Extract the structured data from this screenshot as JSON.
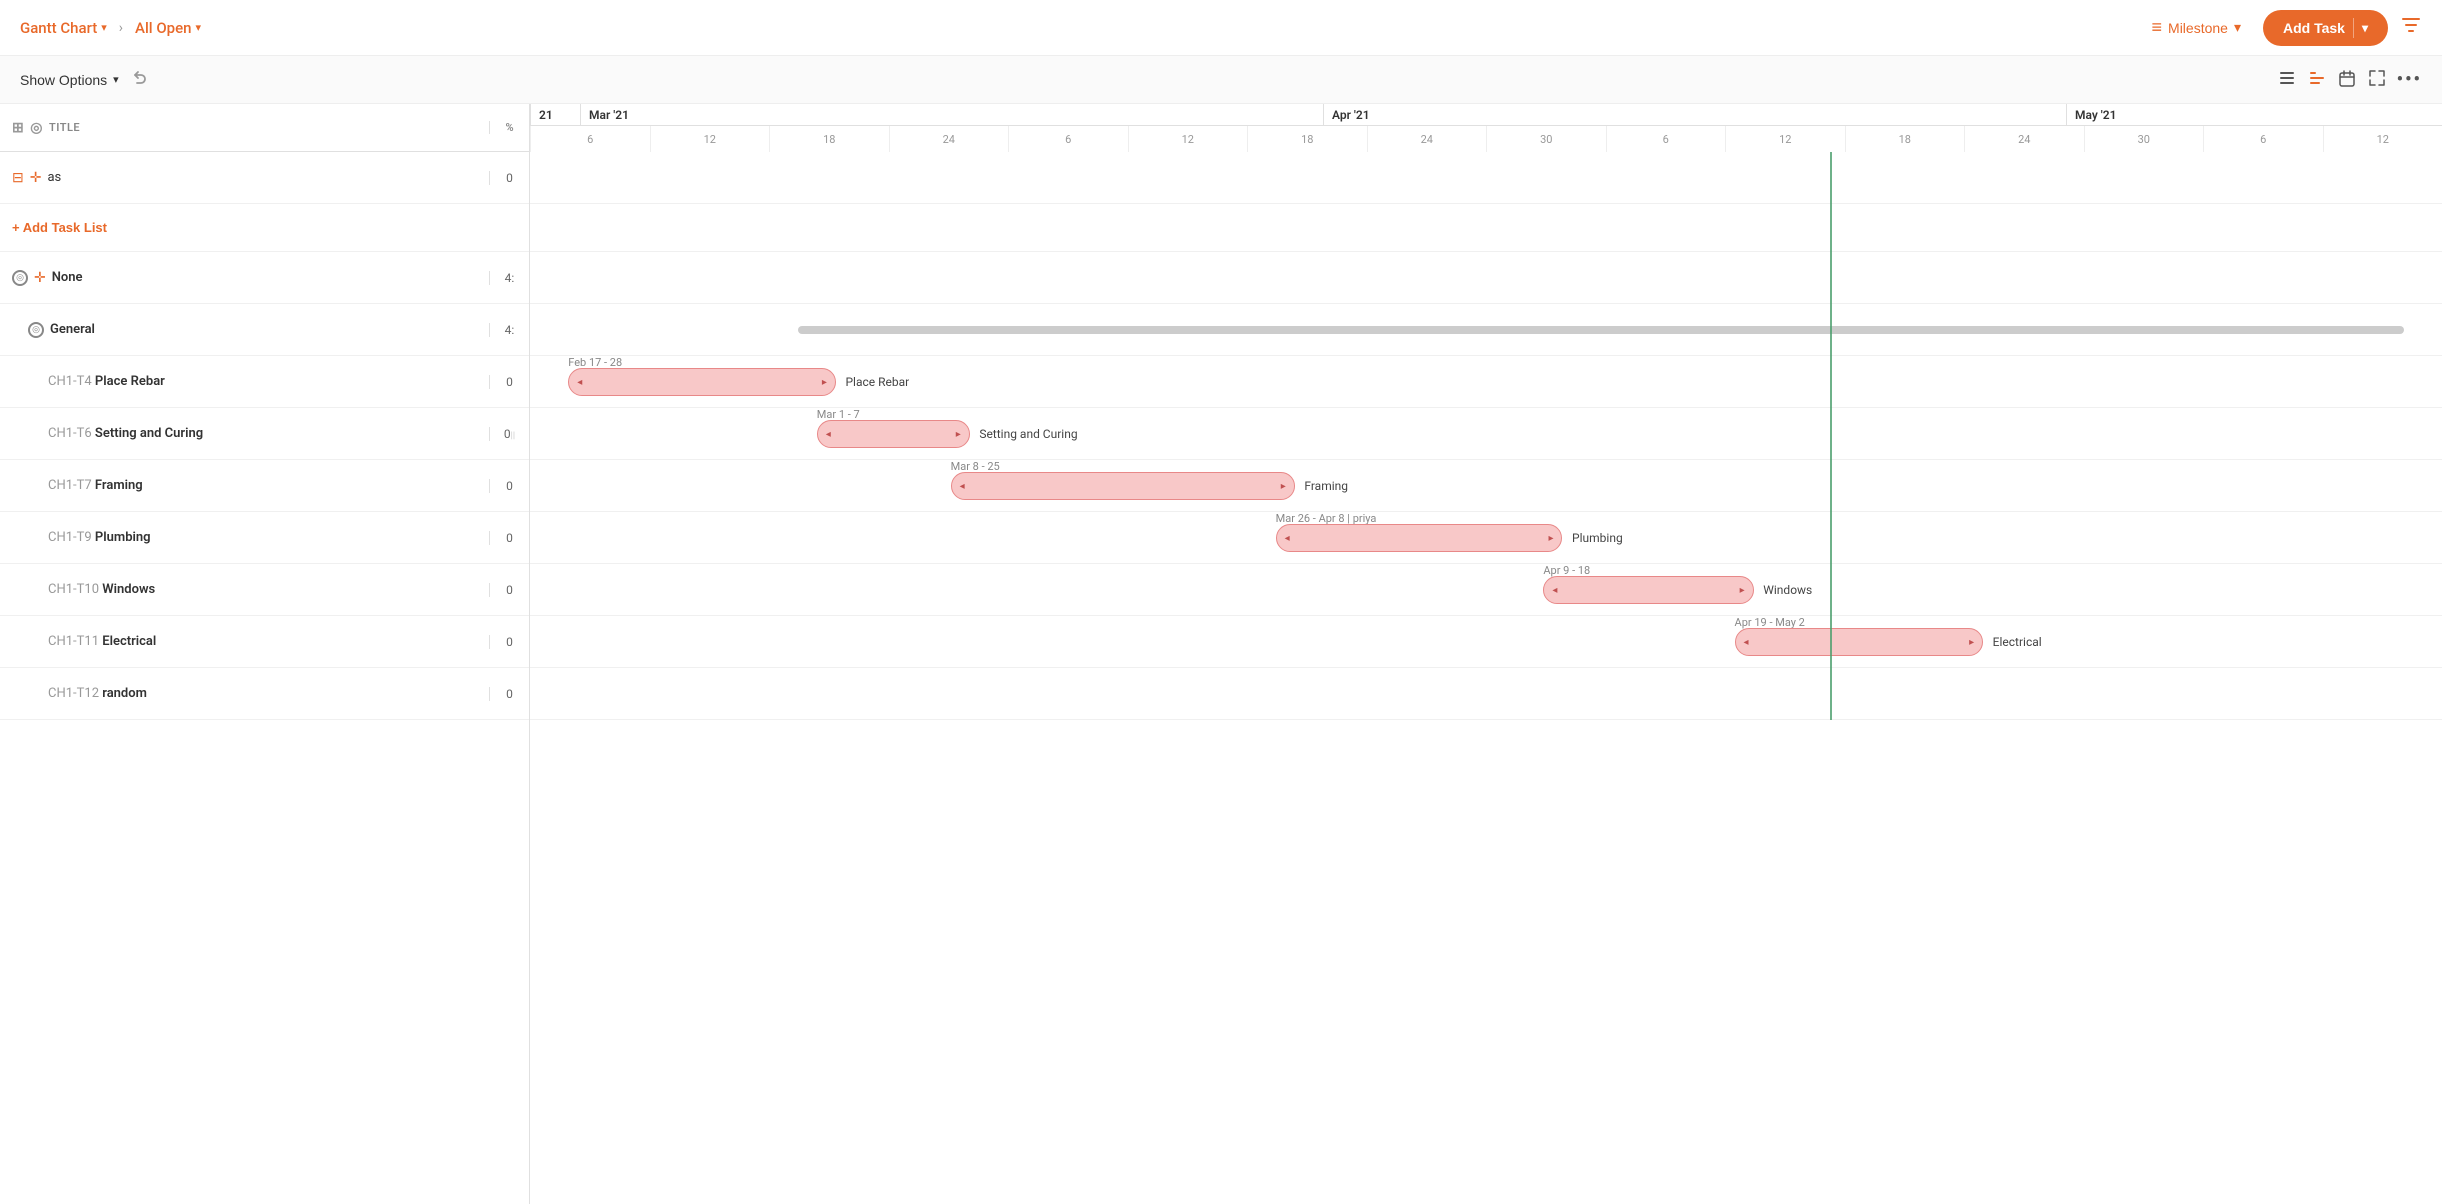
{
  "topbar": {
    "gantt_label": "Gantt Chart",
    "breadcrumb_sep": "›",
    "all_open_label": "All Open",
    "milestone_label": "Milestone",
    "add_task_label": "Add Task",
    "filter_icon": "filter-icon"
  },
  "toolbar": {
    "show_options_label": "Show Options",
    "undo_label": "↩",
    "icons": [
      "list-icon",
      "list-indent-icon",
      "calendar-icon",
      "expand-icon",
      "more-icon"
    ]
  },
  "header": {
    "title_label": "TITLE",
    "pct_label": "%"
  },
  "tasks": [
    {
      "id": "as-row",
      "indent": 0,
      "id_label": "",
      "label": "as",
      "pct": "0",
      "is_section": false,
      "has_move": true,
      "has_circle": true
    },
    {
      "id": "add-task-list",
      "type": "add",
      "label": "Add Task List"
    },
    {
      "id": "none-row",
      "indent": 0,
      "id_label": "",
      "label": "None",
      "pct": "4:",
      "is_section": true,
      "has_move": true,
      "has_circle": true
    },
    {
      "id": "general-row",
      "indent": 1,
      "id_label": "",
      "label": "General",
      "pct": "4:",
      "is_section": true,
      "has_circle": true
    },
    {
      "id": "t4-row",
      "indent": 2,
      "id_label": "CH1-T4",
      "label": "Place Rebar",
      "pct": "0",
      "is_section": false
    },
    {
      "id": "t6-row",
      "indent": 2,
      "id_label": "CH1-T6",
      "label": "Setting and Curing",
      "pct": "0",
      "is_section": false,
      "has_resize": true
    },
    {
      "id": "t7-row",
      "indent": 2,
      "id_label": "CH1-T7",
      "label": "Framing",
      "pct": "0",
      "is_section": false
    },
    {
      "id": "t9-row",
      "indent": 2,
      "id_label": "CH1-T9",
      "label": "Plumbing",
      "pct": "0",
      "is_section": false
    },
    {
      "id": "t10-row",
      "indent": 2,
      "id_label": "CH1-T10",
      "label": "Windows",
      "pct": "0",
      "is_section": false
    },
    {
      "id": "t11-row",
      "indent": 2,
      "id_label": "CH1-T11",
      "label": "Electrical",
      "pct": "0",
      "is_section": false
    },
    {
      "id": "t12-row",
      "indent": 2,
      "id_label": "CH1-T12",
      "label": "random",
      "pct": "0",
      "is_section": false
    }
  ],
  "gantt": {
    "months": [
      {
        "label": "21",
        "span": 1
      },
      {
        "label": "Mar '21",
        "span": 6
      },
      {
        "label": "Apr '21",
        "span": 6
      },
      {
        "label": "May '21",
        "span": 3
      }
    ],
    "days": [
      "6",
      "12",
      "18",
      "24",
      "6",
      "12",
      "18",
      "24",
      "30",
      "6",
      "12",
      "18",
      "24",
      "30",
      "6",
      "12"
    ],
    "bars": [
      {
        "row": 4,
        "date_label": "Feb 17 - 28",
        "right_label": "Place Rebar",
        "left_pct": 2,
        "width_pct": 14
      },
      {
        "row": 5,
        "date_label": "Mar 1 - 7",
        "right_label": "Setting and Curing",
        "left_pct": 15,
        "width_pct": 8
      },
      {
        "row": 6,
        "date_label": "Mar 8 - 25",
        "right_label": "Framing",
        "left_pct": 22,
        "width_pct": 18
      },
      {
        "row": 7,
        "date_label": "Mar 26 - Apr 8 | priya",
        "right_label": "Plumbing",
        "left_pct": 39,
        "width_pct": 15
      },
      {
        "row": 8,
        "date_label": "Apr 9 - 18",
        "right_label": "Windows",
        "left_pct": 53,
        "width_pct": 11
      },
      {
        "row": 9,
        "date_label": "Apr 19 - May 2",
        "right_label": "Electrical",
        "left_pct": 63,
        "width_pct": 13
      }
    ],
    "general_bar": {
      "row": 3,
      "left_pct": 14,
      "width_pct": 83,
      "right_label": "General"
    },
    "today_pct": 68,
    "zoom_minus": "−",
    "zoom_divider": "|",
    "zoom_plus": "+",
    "zoom_expand": "⊞"
  },
  "colors": {
    "orange": "#e8692a",
    "bar_fill": "#f8c8c8",
    "bar_border": "#e88888",
    "gray_bar": "#cccccc",
    "today_line": "#4a9e6b"
  }
}
